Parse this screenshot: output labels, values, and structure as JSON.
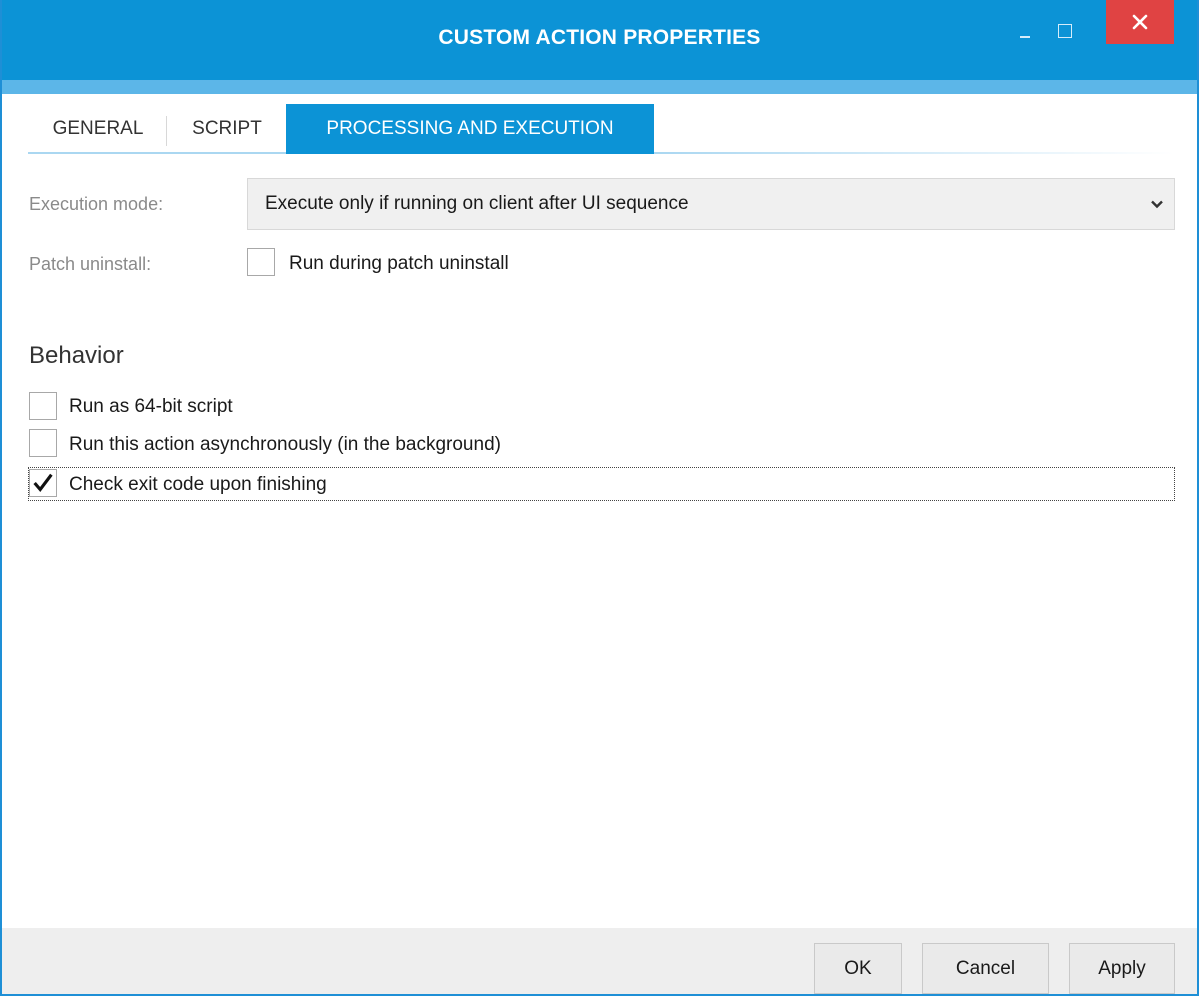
{
  "window": {
    "title": "CUSTOM ACTION PROPERTIES",
    "accent_color": "#0c93d6",
    "close_color": "#e04343"
  },
  "tabs": [
    {
      "label": "GENERAL",
      "active": false
    },
    {
      "label": "SCRIPT",
      "active": false
    },
    {
      "label": "PROCESSING AND EXECUTION",
      "active": true
    }
  ],
  "execution": {
    "label": "Execution mode:",
    "selected": "Execute only if running on client after UI sequence"
  },
  "patch": {
    "label": "Patch uninstall:",
    "checkbox_label": "Run during patch uninstall",
    "checked": false
  },
  "behavior": {
    "title": "Behavior",
    "options": [
      {
        "label": "Run as 64-bit script",
        "checked": false
      },
      {
        "label": "Run this action asynchronously (in the background)",
        "checked": false
      },
      {
        "label": "Check exit code upon finishing",
        "checked": true
      }
    ]
  },
  "buttons": {
    "ok": "OK",
    "cancel": "Cancel",
    "apply": "Apply"
  },
  "icons": {
    "minimize": "minimize-icon",
    "maximize": "maximize-icon",
    "close": "close-icon",
    "dropdown": "chevron-down-icon",
    "check": "checkmark-icon"
  }
}
